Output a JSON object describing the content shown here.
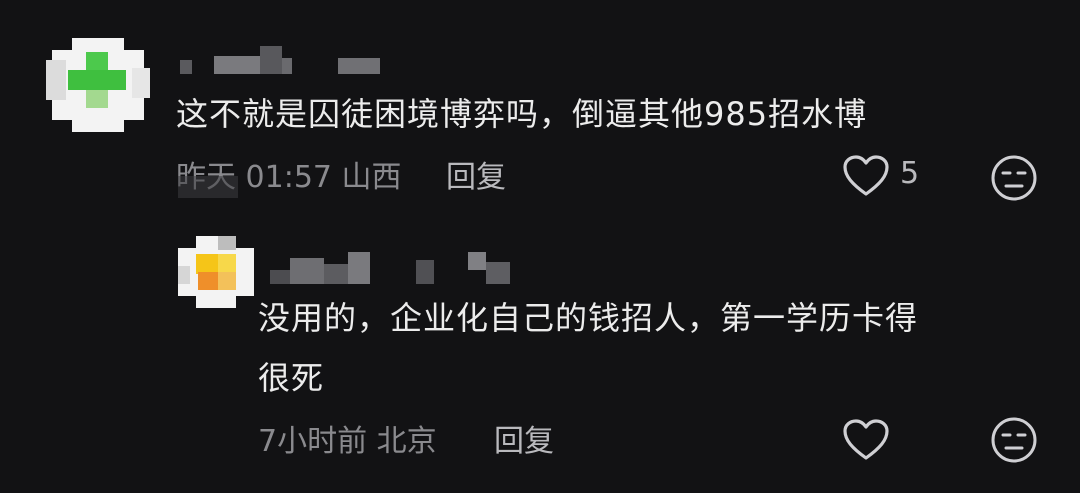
{
  "comments": [
    {
      "text": "这不就是囚徒困境博弈吗，倒逼其他985招水博",
      "time": "昨天 01:57",
      "location": "山西",
      "reply_label": "回复",
      "likes": "5",
      "icons": {
        "like": "heart-icon",
        "react": "meh-face-icon"
      }
    },
    {
      "text_line1": "没用的，企业化自己的钱招人，第一学历卡得",
      "text_line2": "很死",
      "time": "7小时前",
      "location": "北京",
      "reply_label": "回复",
      "icons": {
        "like": "heart-icon",
        "react": "meh-face-icon"
      }
    }
  ],
  "colors": {
    "background": "#121214",
    "text": "#ececec",
    "meta": "#8a8a8e",
    "avatar_green": "#4cc94c",
    "avatar_yellow": "#f5c518"
  }
}
